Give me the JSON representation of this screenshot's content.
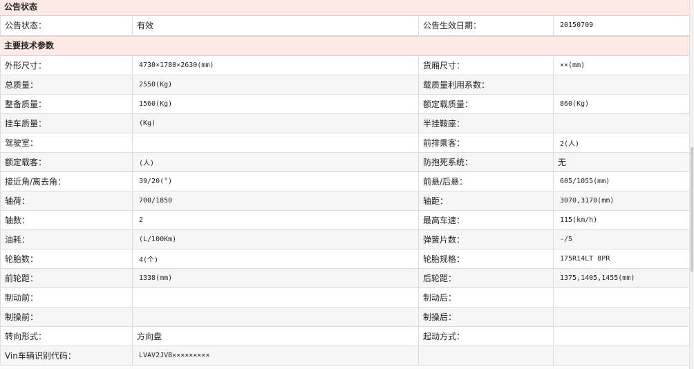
{
  "announcement_section": {
    "title": "公告状态",
    "row": {
      "label1": "公告状态：",
      "value1": "有效",
      "label2": "公告生效日期：",
      "value2": "20150709"
    }
  },
  "tech_section": {
    "title": "主要技术参数",
    "rows": [
      {
        "label1": "外形尺寸：",
        "value1": "4730×1780×2630(mm)",
        "label2": "货厢尺寸：",
        "value2": "××(mm)"
      },
      {
        "label1": "总质量：",
        "value1": "2550(Kg)",
        "label2": "载质量利用系数：",
        "value2": ""
      },
      {
        "label1": "整备质量：",
        "value1": "1560(Kg)",
        "label2": "额定载质量：",
        "value2": "860(Kg)"
      },
      {
        "label1": "挂车质量：",
        "value1": "(Kg)",
        "label2": "半挂鞍座：",
        "value2": ""
      },
      {
        "label1": "驾驶室：",
        "value1": "",
        "label2": "前排乘客：",
        "value2": "2(人)"
      },
      {
        "label1": "额定载客：",
        "value1": "(人)",
        "label2": "防抱死系统：",
        "value2": "无"
      },
      {
        "label1": "接近角/离去角：",
        "value1": "39/20(°)",
        "label2": "前悬/后悬：",
        "value2": "605/1055(mm)"
      },
      {
        "label1": "轴荷：",
        "value1": "700/1850",
        "label2": "轴距：",
        "value2": "3070,3170(mm)"
      },
      {
        "label1": "轴数：",
        "value1": "2",
        "label2": "最高车速：",
        "value2": "115(km/h)"
      },
      {
        "label1": "油耗：",
        "value1": "(L/100Km)",
        "label2": "弹簧片数：",
        "value2": "-/5"
      },
      {
        "label1": "轮胎数：",
        "value1": "4(个)",
        "label2": "轮胎规格：",
        "value2": "175R14LT 8PR"
      },
      {
        "label1": "前轮距：",
        "value1": "1338(mm)",
        "label2": "后轮距：",
        "value2": "1375,1405,1455(mm)"
      },
      {
        "label1": "制动前：",
        "value1": "",
        "label2": "制动后：",
        "value2": ""
      },
      {
        "label1": "制操前：",
        "value1": "",
        "label2": "制操后：",
        "value2": ""
      },
      {
        "label1": "转向形式：",
        "value1": "方向盘",
        "label2": "起动方式：",
        "value2": ""
      },
      {
        "label1": "Vin车辆识别代码：",
        "value1": "LVAV2JVB×××××××××",
        "label2": "",
        "value2": ""
      }
    ]
  }
}
